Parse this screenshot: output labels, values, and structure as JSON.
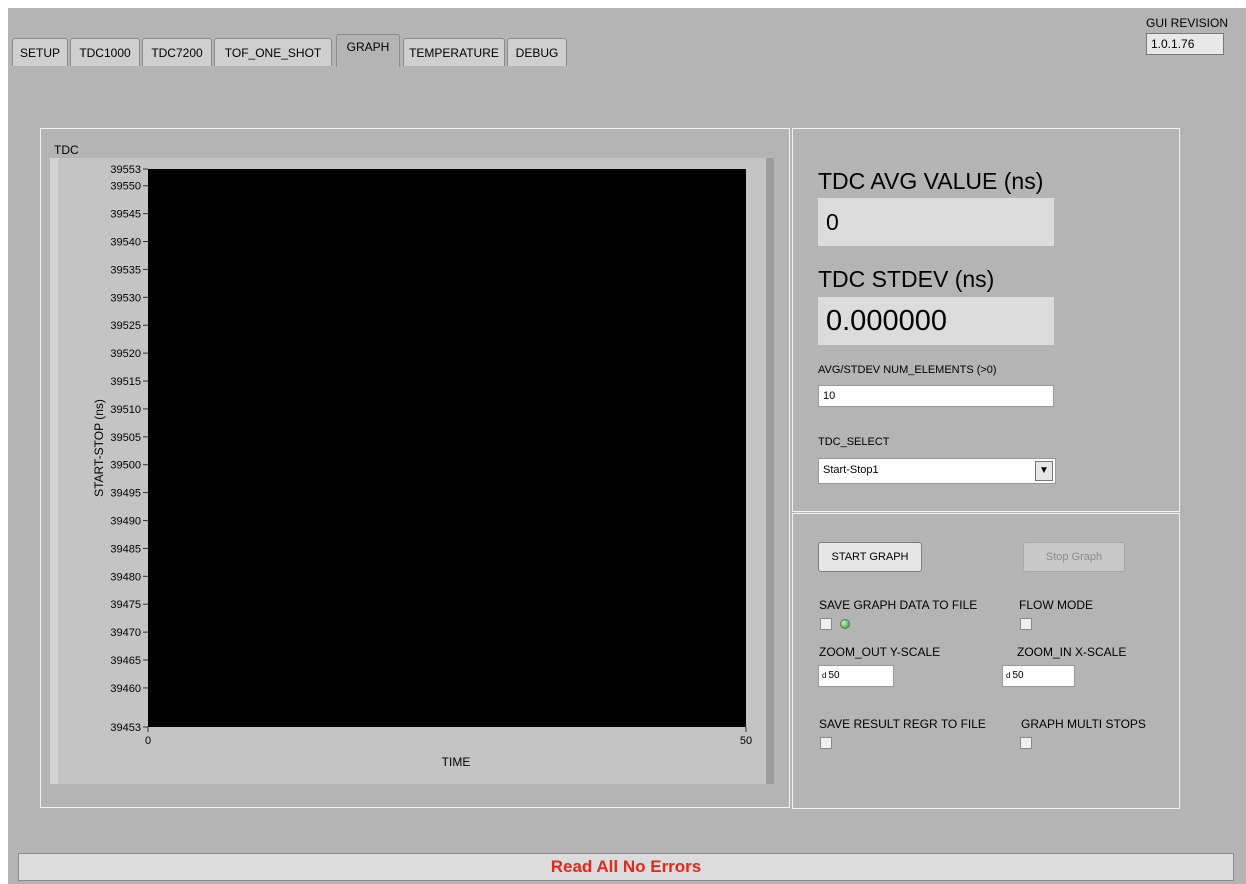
{
  "tabs": [
    {
      "label": "SETUP",
      "active": false
    },
    {
      "label": "TDC1000",
      "active": false
    },
    {
      "label": "TDC7200",
      "active": false
    },
    {
      "label": "TOF_ONE_SHOT",
      "active": false
    },
    {
      "label": "GRAPH",
      "active": true
    },
    {
      "label": "TEMPERATURE",
      "active": false
    },
    {
      "label": "DEBUG",
      "active": false
    }
  ],
  "gui_revision": {
    "label": "GUI REVISION",
    "value": "1.0.1.76"
  },
  "chart": {
    "title": "TDC"
  },
  "chart_data": {
    "type": "line",
    "title": "TDC",
    "xlabel": "TIME",
    "ylabel": "START-STOP (ns)",
    "xlim": [
      0,
      50
    ],
    "ylim": [
      39453,
      39553
    ],
    "x_ticks": [
      "0",
      "50"
    ],
    "y_ticks": [
      "39553",
      "39550",
      "39545",
      "39540",
      "39535",
      "39530",
      "39525",
      "39520",
      "39515",
      "39510",
      "39505",
      "39500",
      "39495",
      "39490",
      "39485",
      "39480",
      "39475",
      "39470",
      "39465",
      "39460",
      "39453"
    ],
    "y_tick_values": [
      39553,
      39550,
      39545,
      39540,
      39535,
      39530,
      39525,
      39520,
      39515,
      39510,
      39505,
      39500,
      39495,
      39490,
      39485,
      39480,
      39475,
      39470,
      39465,
      39460,
      39453
    ],
    "plot_background": "#000000",
    "series": []
  },
  "stats": {
    "avg_label": "TDC AVG VALUE (ns)",
    "avg_value": "0",
    "stdev_label": "TDC STDEV (ns)",
    "stdev_value": "0.000000",
    "num_elements_label": "AVG/STDEV NUM_ELEMENTS (>0)",
    "num_elements_value": "10",
    "tdc_select_label": "TDC_SELECT",
    "tdc_select_value": "Start-Stop1"
  },
  "controls": {
    "start_graph": "START GRAPH",
    "stop_graph": "Stop Graph",
    "save_graph_label": "SAVE GRAPH DATA TO FILE",
    "flow_mode_label": "FLOW MODE",
    "zoom_out_label": "ZOOM_OUT Y-SCALE",
    "zoom_out_radix": "d",
    "zoom_out_value": "50",
    "zoom_in_label": "ZOOM_IN X-SCALE",
    "zoom_in_radix": "d",
    "zoom_in_value": "50",
    "save_regr_label": "SAVE RESULT REGR TO FILE",
    "graph_multi_label": "GRAPH MULTI STOPS"
  },
  "status": {
    "text": "Read All No Errors",
    "color": "#e8271c"
  },
  "colors": {
    "panel": "#b4b4b4",
    "plot_bg": "#000000",
    "status_text": "#e8271c"
  }
}
